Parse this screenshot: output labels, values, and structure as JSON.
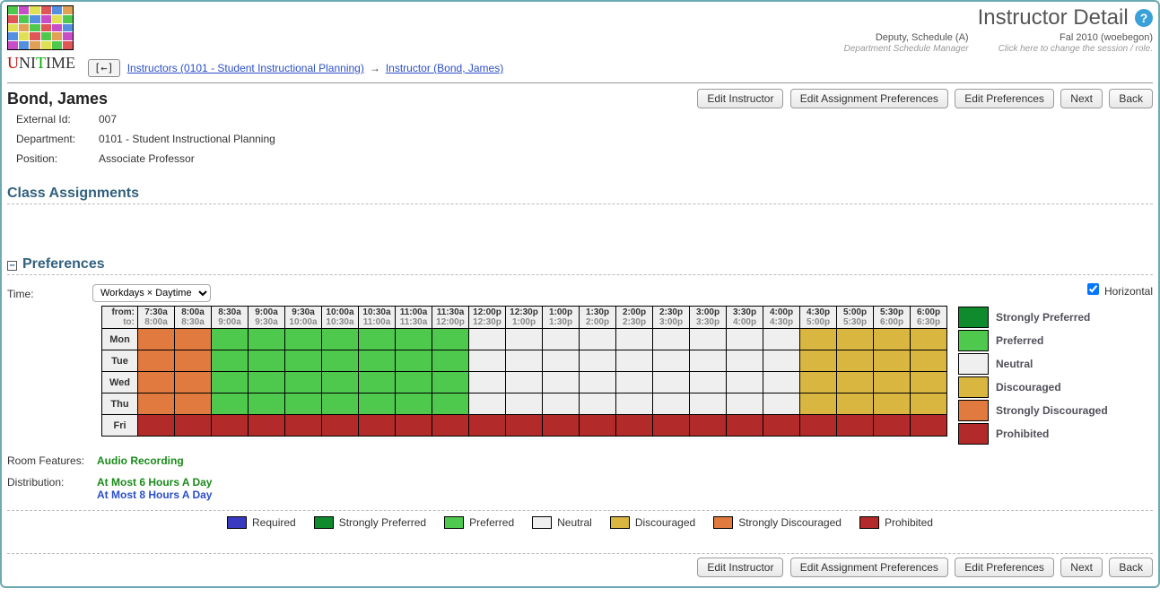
{
  "page_title": "Instructor Detail",
  "session": {
    "user_line": "Deputy, Schedule (A)",
    "user_sub": "Department Schedule Manager",
    "term_line": "Fal 2010 (woebegon)",
    "term_sub": "Click here to change the session / role."
  },
  "logo_text_parts": {
    "u": "U",
    "ni": "NI",
    "t": "T",
    "ime": "IME"
  },
  "breadcrumb": {
    "back_icon": "[←]",
    "link1": "Instructors (0101 - Student Instructional Planning)",
    "arrow": "→",
    "link2": "Instructor (Bond, James)"
  },
  "buttons": {
    "edit_instructor": "Edit Instructor",
    "edit_assign_prefs": "Edit Assignment Preferences",
    "edit_prefs": "Edit Preferences",
    "next": "Next",
    "back": "Back"
  },
  "instructor": {
    "name": "Bond, James",
    "external_id_label": "External Id:",
    "external_id": "007",
    "department_label": "Department:",
    "department": "0101 - Student Instructional Planning",
    "position_label": "Position:",
    "position": "Associate Professor"
  },
  "sections": {
    "class_assignments": "Class Assignments",
    "preferences": "Preferences"
  },
  "time_section": {
    "label": "Time:",
    "select_value": "Workdays × Daytime",
    "horizontal_label": "Horizontal",
    "from_label": "from:",
    "to_label": "to:",
    "columns": [
      {
        "from": "7:30a",
        "to": "8:00a"
      },
      {
        "from": "8:00a",
        "to": "8:30a"
      },
      {
        "from": "8:30a",
        "to": "9:00a"
      },
      {
        "from": "9:00a",
        "to": "9:30a"
      },
      {
        "from": "9:30a",
        "to": "10:00a"
      },
      {
        "from": "10:00a",
        "to": "10:30a"
      },
      {
        "from": "10:30a",
        "to": "11:00a"
      },
      {
        "from": "11:00a",
        "to": "11:30a"
      },
      {
        "from": "11:30a",
        "to": "12:00p"
      },
      {
        "from": "12:00p",
        "to": "12:30p"
      },
      {
        "from": "12:30p",
        "to": "1:00p"
      },
      {
        "from": "1:00p",
        "to": "1:30p"
      },
      {
        "from": "1:30p",
        "to": "2:00p"
      },
      {
        "from": "2:00p",
        "to": "2:30p"
      },
      {
        "from": "2:30p",
        "to": "3:00p"
      },
      {
        "from": "3:00p",
        "to": "3:30p"
      },
      {
        "from": "3:30p",
        "to": "4:00p"
      },
      {
        "from": "4:00p",
        "to": "4:30p"
      },
      {
        "from": "4:30p",
        "to": "5:00p"
      },
      {
        "from": "5:00p",
        "to": "5:30p"
      },
      {
        "from": "5:30p",
        "to": "6:00p"
      },
      {
        "from": "6:00p",
        "to": "6:30p"
      }
    ],
    "days": [
      "Mon",
      "Tue",
      "Wed",
      "Thu",
      "Fri"
    ],
    "cells": [
      [
        "sdisc",
        "sdisc",
        "pref",
        "pref",
        "pref",
        "pref",
        "pref",
        "pref",
        "pref",
        "neut",
        "neut",
        "neut",
        "neut",
        "neut",
        "neut",
        "neut",
        "neut",
        "neut",
        "disc",
        "disc",
        "disc",
        "disc"
      ],
      [
        "sdisc",
        "sdisc",
        "pref",
        "pref",
        "pref",
        "pref",
        "pref",
        "pref",
        "pref",
        "neut",
        "neut",
        "neut",
        "neut",
        "neut",
        "neut",
        "neut",
        "neut",
        "neut",
        "disc",
        "disc",
        "disc",
        "disc"
      ],
      [
        "sdisc",
        "sdisc",
        "pref",
        "pref",
        "pref",
        "pref",
        "pref",
        "pref",
        "pref",
        "neut",
        "neut",
        "neut",
        "neut",
        "neut",
        "neut",
        "neut",
        "neut",
        "neut",
        "disc",
        "disc",
        "disc",
        "disc"
      ],
      [
        "sdisc",
        "sdisc",
        "pref",
        "pref",
        "pref",
        "pref",
        "pref",
        "pref",
        "pref",
        "neut",
        "neut",
        "neut",
        "neut",
        "neut",
        "neut",
        "neut",
        "neut",
        "neut",
        "disc",
        "disc",
        "disc",
        "disc"
      ],
      [
        "prohib",
        "prohib",
        "prohib",
        "prohib",
        "prohib",
        "prohib",
        "prohib",
        "prohib",
        "prohib",
        "prohib",
        "prohib",
        "prohib",
        "prohib",
        "prohib",
        "prohib",
        "prohib",
        "prohib",
        "prohib",
        "prohib",
        "prohib",
        "prohib",
        "prohib"
      ]
    ]
  },
  "legend": [
    {
      "key": "spref",
      "label": "Strongly Preferred"
    },
    {
      "key": "pref",
      "label": "Preferred"
    },
    {
      "key": "neut",
      "label": "Neutral"
    },
    {
      "key": "disc",
      "label": "Discouraged"
    },
    {
      "key": "sdisc",
      "label": "Strongly Discouraged"
    },
    {
      "key": "prohib",
      "label": "Prohibited"
    }
  ],
  "bottom_legend": [
    {
      "key": "req",
      "label": "Required"
    },
    {
      "key": "spref",
      "label": "Strongly Preferred"
    },
    {
      "key": "pref",
      "label": "Preferred"
    },
    {
      "key": "neut",
      "label": "Neutral"
    },
    {
      "key": "disc",
      "label": "Discouraged"
    },
    {
      "key": "sdisc",
      "label": "Strongly Discouraged"
    },
    {
      "key": "prohib",
      "label": "Prohibited"
    }
  ],
  "room_features": {
    "label": "Room Features:",
    "value": "Audio Recording"
  },
  "distribution": {
    "label": "Distribution:",
    "values": [
      "At Most 6 Hours A Day",
      "At Most 8 Hours A Day"
    ]
  },
  "colors": {
    "spref": "#0f8a2d",
    "pref": "#4ec94e",
    "neut": "#efefef",
    "disc": "#d9b63f",
    "sdisc": "#e07a3e",
    "prohib": "#b22a2a",
    "req": "#3a3ac0"
  }
}
